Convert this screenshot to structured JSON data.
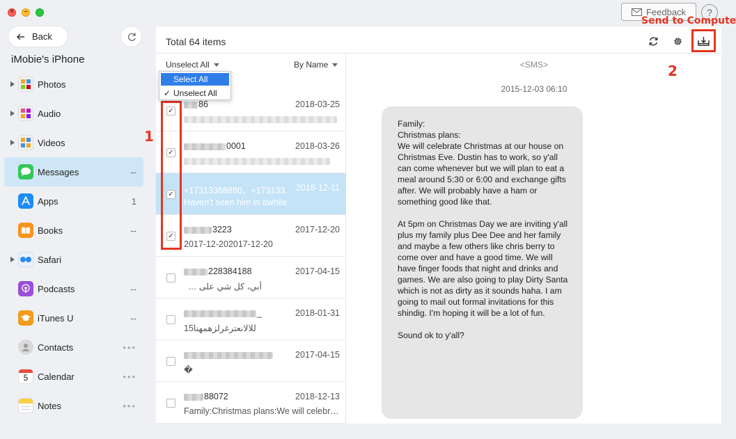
{
  "window": {
    "feedback_label": "Feedback",
    "help_label": "?"
  },
  "sidebar": {
    "back_label": "Back",
    "device_name": "iMobie's iPhone",
    "items": [
      {
        "label": "Photos",
        "count": "",
        "expandable": true,
        "icon": "photos-icon"
      },
      {
        "label": "Audio",
        "count": "",
        "expandable": true,
        "icon": "audio-icon"
      },
      {
        "label": "Videos",
        "count": "",
        "expandable": true,
        "icon": "videos-icon"
      },
      {
        "label": "Messages",
        "count": "--",
        "expandable": false,
        "icon": "messages-icon"
      },
      {
        "label": "Apps",
        "count": "1",
        "expandable": false,
        "icon": "apps-icon"
      },
      {
        "label": "Books",
        "count": "--",
        "expandable": false,
        "icon": "books-icon"
      },
      {
        "label": "Safari",
        "count": "",
        "expandable": true,
        "icon": "safari-icon"
      },
      {
        "label": "Podcasts",
        "count": "--",
        "expandable": false,
        "icon": "podcasts-icon"
      },
      {
        "label": "iTunes U",
        "count": "--",
        "expandable": false,
        "icon": "itunes-u-icon"
      },
      {
        "label": "Contacts",
        "count": "•••",
        "expandable": false,
        "icon": "contacts-icon"
      },
      {
        "label": "Calendar",
        "count": "•••",
        "expandable": false,
        "icon": "calendar-icon"
      },
      {
        "label": "Notes",
        "count": "•••",
        "expandable": false,
        "icon": "notes-icon"
      }
    ]
  },
  "main": {
    "total_label": "Total 64 items",
    "unselect_label": "Unselect All",
    "sort_label": "By Name",
    "dropdown_options": [
      "Select All",
      "Unselect All"
    ],
    "rows": [
      {
        "name": "86",
        "date": "2018-03-25",
        "preview": "",
        "checked": true,
        "selected": false
      },
      {
        "name": "0001",
        "date": "2018-03-26",
        "preview": "",
        "checked": true,
        "selected": false
      },
      {
        "name": "+17313368880、+173133.",
        "date": "2018-12-11",
        "preview": "Haven't seen him in awhile",
        "checked": true,
        "selected": true
      },
      {
        "name": "3223",
        "date": "2017-12-20",
        "preview": "2017-12-202017-12-20",
        "checked": true,
        "selected": false
      },
      {
        "name": "228384188",
        "date": "2017-04-15",
        "preview": "أبي، كل شي على ما يرام",
        "checked": false,
        "selected": false
      },
      {
        "name": "_",
        "date": "2018-01-31",
        "preview": "للالانعترغرلزهمهنا15",
        "checked": false,
        "selected": false
      },
      {
        "name": "",
        "date": "2017-04-15",
        "preview": "�",
        "checked": false,
        "selected": false
      },
      {
        "name": "88072",
        "date": "2018-12-13",
        "preview": "Family:Christmas plans:We will celebr…",
        "checked": false,
        "selected": false
      }
    ]
  },
  "detail": {
    "type_tag": "<SMS>",
    "timestamp": "2015-12-03 06:10",
    "message": "Family:\nChristmas plans:\nWe will celebrate Christmas at our house on\nChristmas Eve. Dustin has to work, so y'all\ncan come whenever but we will plan to eat a\nmeal around 5:30 or 6:00 and exchange gifts\nafter. We will probably have a ham or\nsomething good like that.\n\nAt 5pm on Christmas Day we are inviting y'all\nplus my family plus Dee Dee and her family\nand maybe a few others like chris berry to\ncome over and have a good time. We will\nhave finger foods that night and drinks and\ngames. We are also going to play Dirty Santa\nwhich is not as dirty as it sounds haha. I am\ngoing to mail out formal invitations for this\nshindig. I'm hoping it will be a lot of fun.\n\nSound ok to y'all?"
  },
  "annotations": {
    "step1": "1",
    "step2": "2",
    "send_to_computer": "Send to Computer"
  },
  "colors": {
    "accent": "#2f7ee8",
    "annotation_red": "#e53520",
    "selected_row": "#c4e3f7",
    "active_sidebar": "#cfe6f7"
  }
}
